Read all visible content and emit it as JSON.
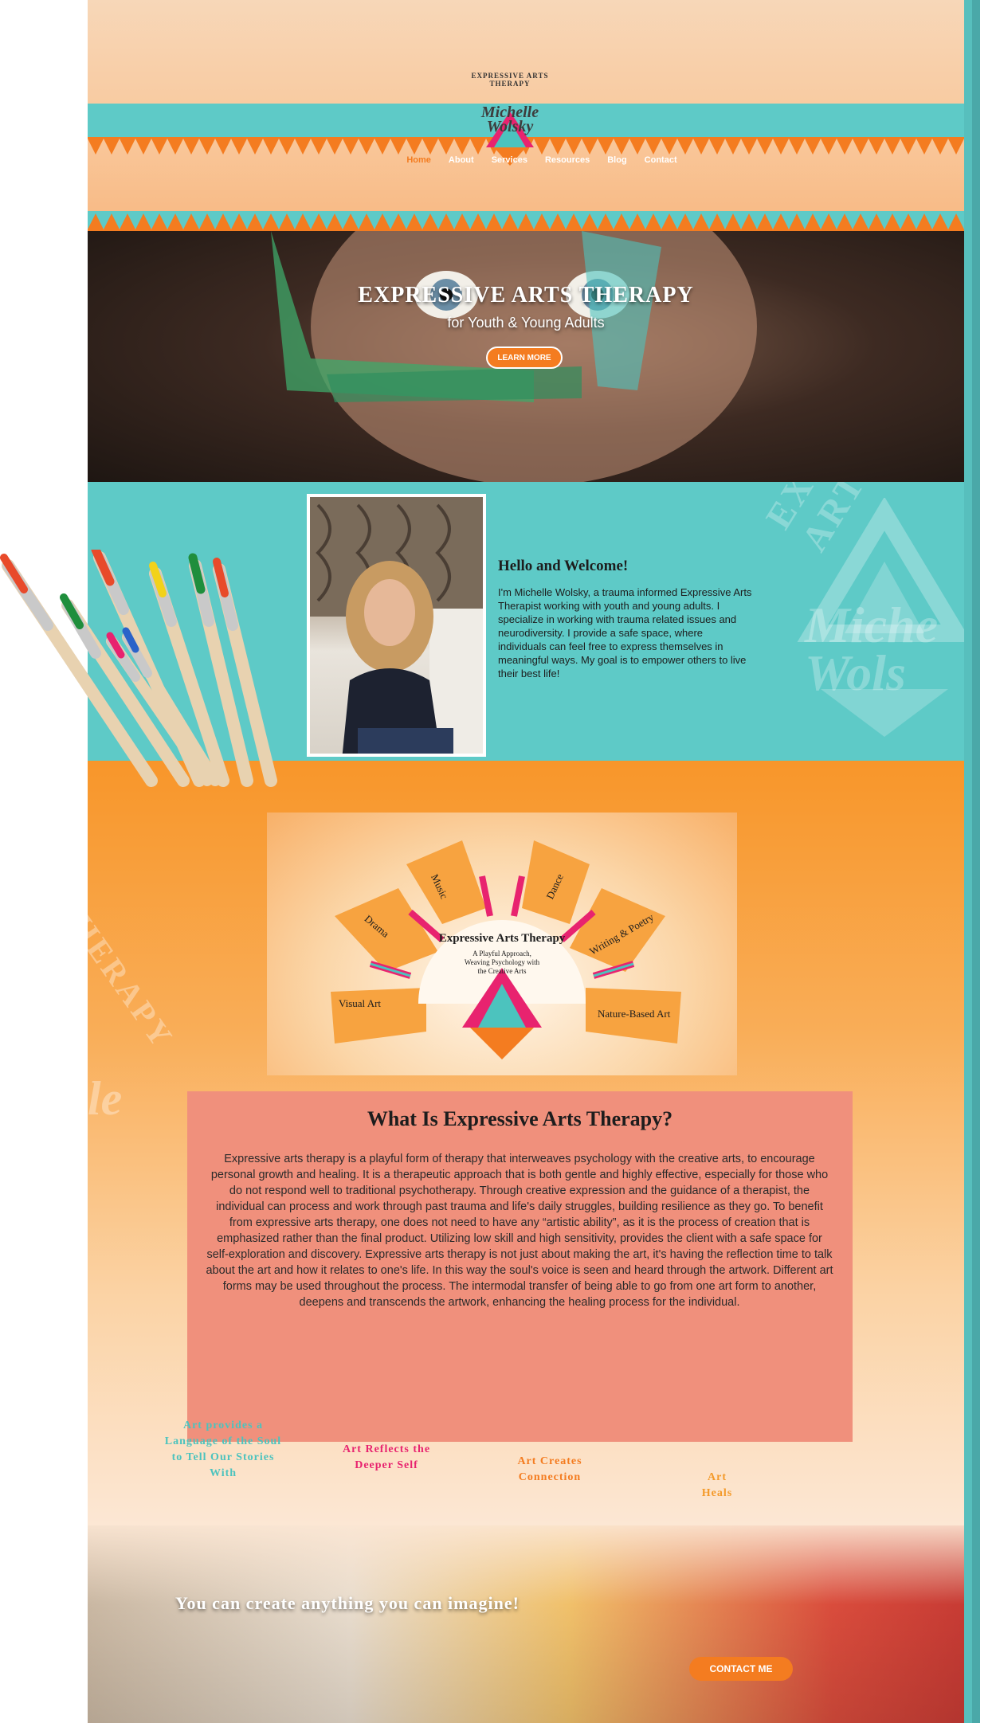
{
  "logo": {
    "ring_text": "EXPRESSIVE ARTS THERAPY",
    "name_line1": "Michelle",
    "name_line2": "Wolsky"
  },
  "nav": {
    "items": [
      "Home",
      "About",
      "Services",
      "Resources",
      "Blog",
      "Contact"
    ],
    "active": "Home"
  },
  "hero": {
    "title": "EXPRESSIVE ARTS THERAPY",
    "subtitle": "for Youth & Young Adults",
    "button": "LEARN MORE"
  },
  "welcome": {
    "heading": "Hello and Welcome!",
    "body": "I'm Michelle Wolsky, a trauma informed Expressive Arts Therapist working with youth and young adults. I specialize in working with trauma related issues and neurodiversity. I provide a safe space, where individuals can feel free to express themselves in meaningful ways. My goal is to empower others to live their best life!",
    "watermark_ring": "EXPRESSIVE ARTS",
    "watermark_name1": "Miche",
    "watermark_name2": "Wols"
  },
  "sunburst": {
    "rays": [
      "Visual Art",
      "Drama",
      "Music",
      "Dance",
      "Writing & Poetry",
      "Nature-Based Art"
    ],
    "arc_title": "Expressive Arts Therapy",
    "tagline_line1": "A Playful Approach,",
    "tagline_line2": "Weaving Psychology with",
    "tagline_line3": "the Creative Arts"
  },
  "side_watermark": {
    "text": "THERAPY",
    "name": "le"
  },
  "what": {
    "heading": "What Is Expressive Arts Therapy?",
    "body": "Expressive arts therapy is a playful form of therapy that interweaves psychology with the creative arts, to encourage personal growth and healing. It is a therapeutic approach that is both gentle and highly effective, especially for those who do not respond well to traditional psychotherapy. Through creative expression and the guidance of a therapist, the individual can process and work through past trauma and life's daily struggles, building resilience as they go. To benefit from expressive arts therapy, one does not need to have any “artistic ability”, as it is the process of creation that is emphasized rather than the final product. Utilizing low skill and high sensitivity, provides the client with a safe space for self-exploration and discovery. Expressive arts therapy is not just about making the art, it's having the reflection time to talk about the art and how it relates to one's life. In this way the soul's voice is seen and heard through the artwork. Different art forms may be used throughout the process. The intermodal transfer of being able to go from one art form to another, deepens and transcends the artwork, enhancing the healing process for the individual."
  },
  "quotes": [
    {
      "text": "Art provides a Language of the Soul to Tell Our Stories With",
      "color": "#4cc3be"
    },
    {
      "text": "Art Reflects the Deeper Self",
      "color": "#e8236f"
    },
    {
      "text": "Art Creates Connection",
      "color": "#f47c20"
    },
    {
      "text": "Art Heals",
      "color": "#f49a2a"
    }
  ],
  "bottom": {
    "tagline": "You can create anything you can imagine!",
    "button": "CONTACT ME"
  },
  "colors": {
    "teal": "#5ecac7",
    "orange": "#f47c20",
    "salmon": "#f0907c",
    "pink": "#e8236f"
  }
}
